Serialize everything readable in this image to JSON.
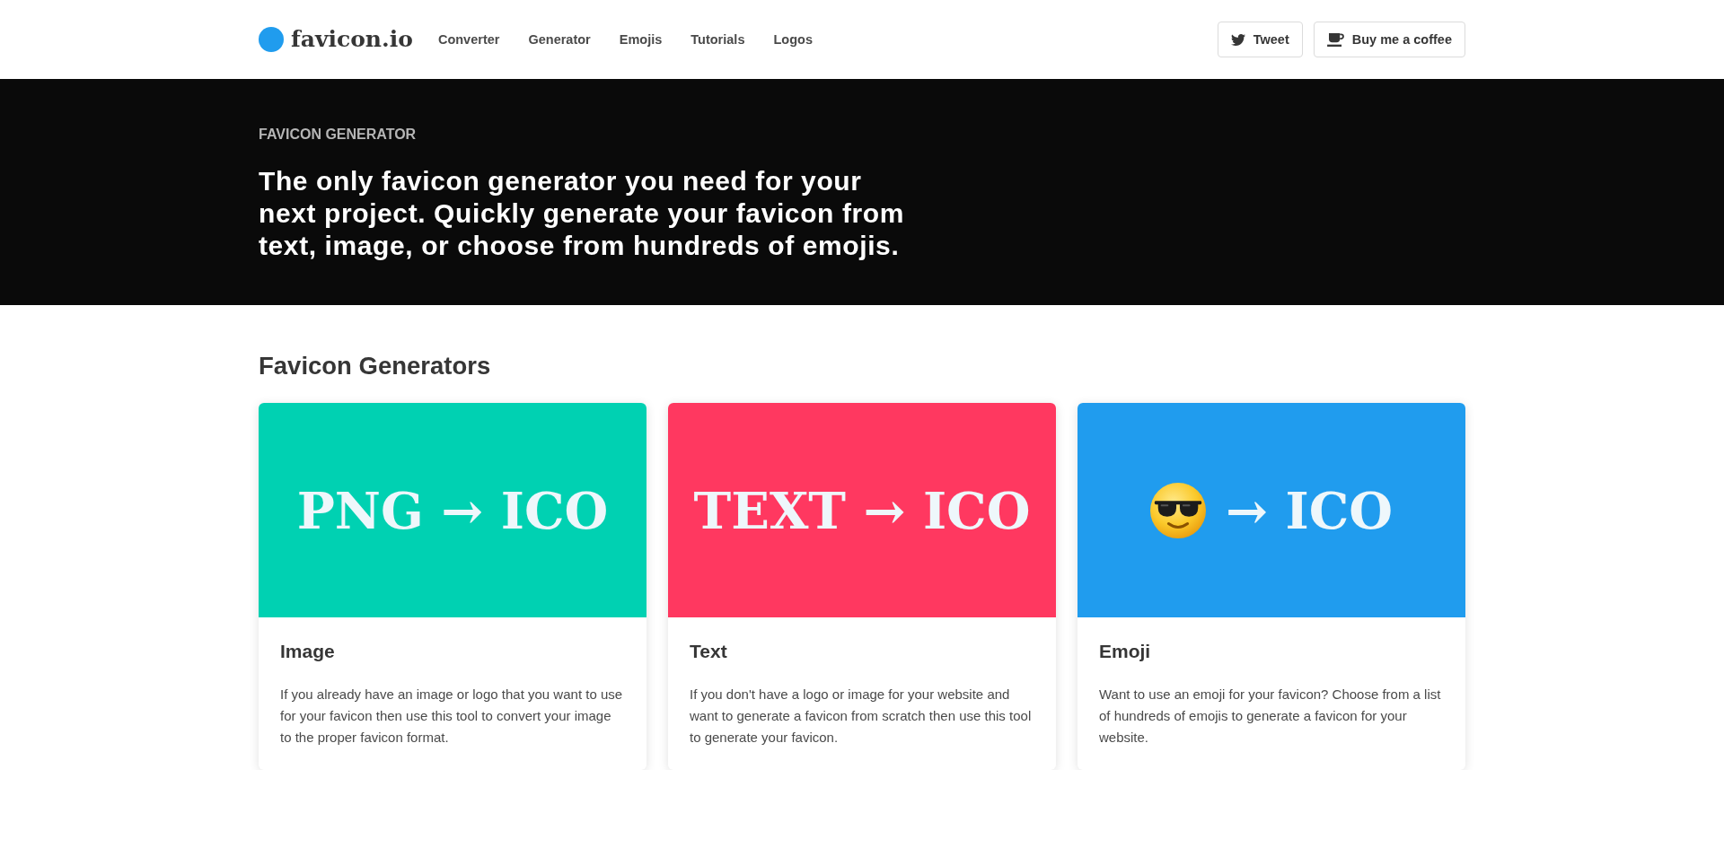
{
  "header": {
    "logo": {
      "text": "favicon.io"
    },
    "nav": [
      {
        "label": "Converter"
      },
      {
        "label": "Generator"
      },
      {
        "label": "Emojis"
      },
      {
        "label": "Tutorials"
      },
      {
        "label": "Logos"
      }
    ],
    "buttons": [
      {
        "kind": "tweet",
        "label": "Tweet"
      },
      {
        "kind": "coffee",
        "label": "Buy me a coffee"
      }
    ]
  },
  "hero": {
    "eyebrow": "FAVICON GENERATOR",
    "headline": "The only favicon generator you need for your next project. Quickly generate your favicon from text, image, or choose from hundreds of emojis."
  },
  "section": {
    "title": "Favicon Generators",
    "cards": [
      {
        "color": "#00d1b2",
        "banner": {
          "kind": "text",
          "label": "PNG → ICO"
        },
        "title": "Image",
        "description": "If you already have an image or logo that you want to use for your favicon then use this tool to convert your image to the proper favicon format."
      },
      {
        "color": "#ff3860",
        "banner": {
          "kind": "text",
          "label": "TEXT → ICO"
        },
        "title": "Text",
        "description": "If you don't have a logo or image for your website and want to generate a favicon from scratch then use this tool to generate your favicon."
      },
      {
        "color": "#209cee",
        "banner": {
          "kind": "emoji",
          "label": "→ ICO"
        },
        "title": "Emoji",
        "description": "Want to use an emoji for your favicon? Choose from a list of hundreds of emojis to generate a favicon for your website."
      }
    ]
  }
}
